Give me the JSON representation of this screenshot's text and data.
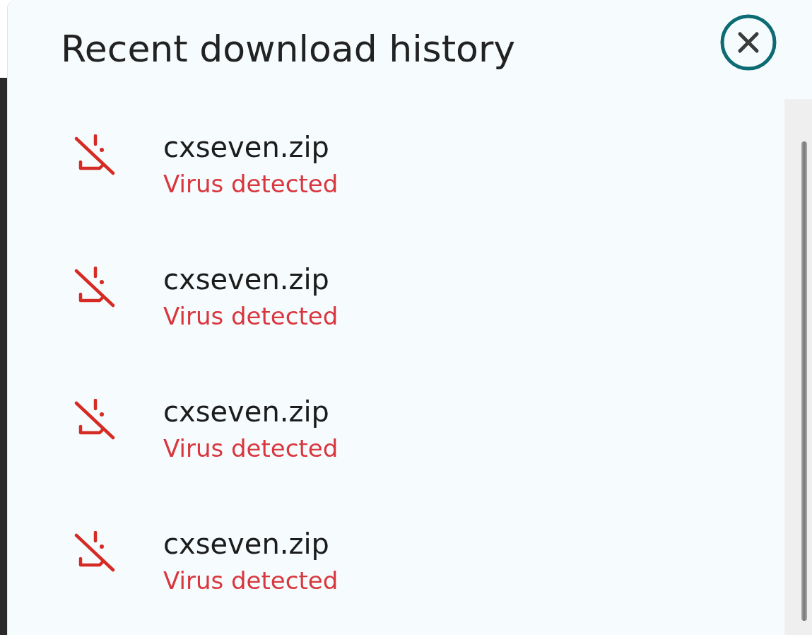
{
  "panel": {
    "title": "Recent download history"
  },
  "downloads": [
    {
      "file_name": "cxseven.zip",
      "status": "Virus detected"
    },
    {
      "file_name": "cxseven.zip",
      "status": "Virus detected"
    },
    {
      "file_name": "cxseven.zip",
      "status": "Virus detected"
    },
    {
      "file_name": "cxseven.zip",
      "status": "Virus detected"
    }
  ]
}
